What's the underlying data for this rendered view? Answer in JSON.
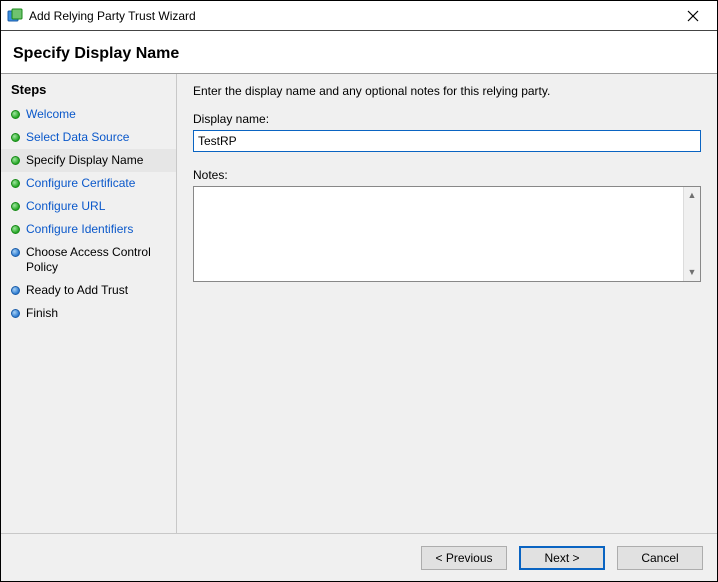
{
  "window": {
    "title": "Add Relying Party Trust Wizard"
  },
  "page": {
    "heading": "Specify Display Name"
  },
  "sidebar": {
    "heading": "Steps",
    "items": [
      {
        "label": "Welcome",
        "state": "done"
      },
      {
        "label": "Select Data Source",
        "state": "done"
      },
      {
        "label": "Specify Display Name",
        "state": "current"
      },
      {
        "label": "Configure Certificate",
        "state": "done"
      },
      {
        "label": "Configure URL",
        "state": "done"
      },
      {
        "label": "Configure Identifiers",
        "state": "done"
      },
      {
        "label": "Choose Access Control Policy",
        "state": "upcoming"
      },
      {
        "label": "Ready to Add Trust",
        "state": "upcoming"
      },
      {
        "label": "Finish",
        "state": "upcoming"
      }
    ]
  },
  "content": {
    "instruction": "Enter the display name and any optional notes for this relying party.",
    "display_name_label": "Display name:",
    "display_name_value": "TestRP",
    "notes_label": "Notes:",
    "notes_value": ""
  },
  "buttons": {
    "previous": "< Previous",
    "next": "Next >",
    "cancel": "Cancel"
  }
}
